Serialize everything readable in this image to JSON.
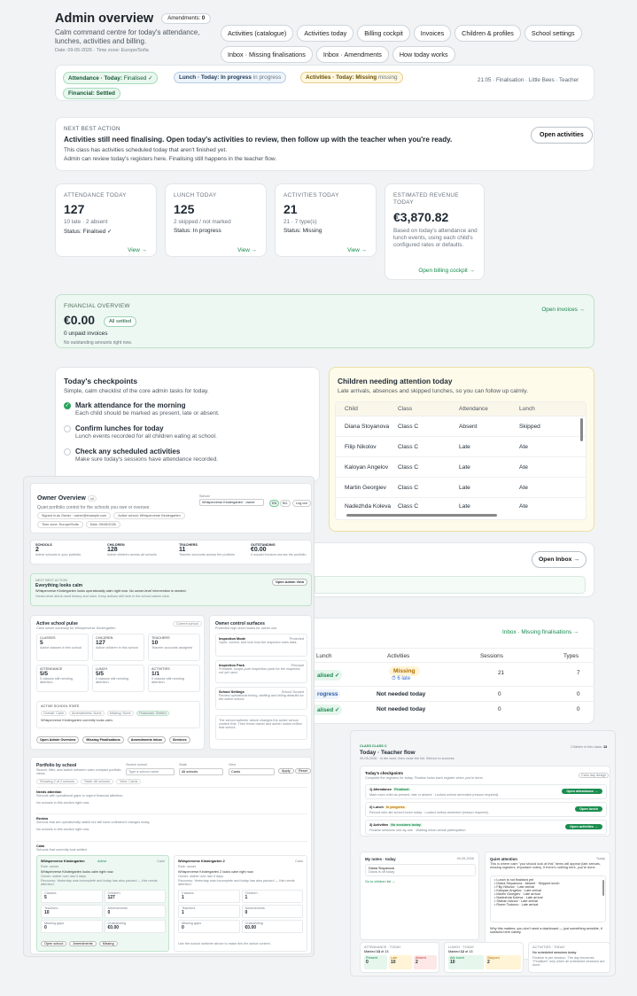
{
  "header": {
    "title": "Admin overview",
    "amend_label": "Amendments:",
    "amend_value": "0",
    "subtitle_1": "Calm command centre for today's attendance,",
    "subtitle_2": "lunches, activities and billing.",
    "meta": "Date: 09-05-2026 · Time zone: Europe/Sofia"
  },
  "nav": [
    "Activities (catalogue)",
    "Activities today",
    "Billing cockpit",
    "Invoices",
    "Children & profiles",
    "School settings",
    "Inbox · Missing finalisations",
    "Inbox · Amendments",
    "How today works"
  ],
  "status": {
    "attendance_label": "Attendance · Today:",
    "attendance_value": "Finalised ✓",
    "lunch_label": "Lunch · Today:",
    "lunch_value": "In progress",
    "lunch_hint": "in progress",
    "activities_label": "Activities · Today:",
    "activities_value": "Missing",
    "activities_hint": "missing",
    "financial_label": "Financial:",
    "financial_value": "Settled",
    "right_note": "21:05 · Finalisation · Little Bees · Teacher"
  },
  "next_action": {
    "kicker": "NEXT BEST ACTION",
    "headline": "Activities still need finalising. Open today's activities to review, then follow up with the teacher when you're ready.",
    "line1": "This class has activities scheduled today that aren't finished yet.",
    "line2": "Admin can review today's registers here. Finalising still happens in the teacher flow.",
    "button": "Open activities"
  },
  "stats": [
    {
      "kicker": "ATTENDANCE TODAY",
      "value": "127",
      "detail": "10 late · 2 absent",
      "status": "Status: Finalised ✓",
      "link": "View →"
    },
    {
      "kicker": "LUNCH TODAY",
      "value": "125",
      "detail": "2 skipped / not marked",
      "status": "Status: In progress",
      "link": "View →"
    },
    {
      "kicker": "ACTIVITIES TODAY",
      "value": "21",
      "detail": "21 · 7 type(s)",
      "status": "Status: Missing",
      "link": "View →"
    },
    {
      "kicker": "ESTIMATED REVENUE TODAY",
      "value": "€3,870.82",
      "detail": "Based on today's attendance and lunch events, using each child's configured rates or defaults.",
      "link": "Open billing cockpit →"
    }
  ],
  "financial": {
    "kicker": "FINANCIAL OVERVIEW",
    "amount": "€0.00",
    "badge": "All settled",
    "unpaid": "0 unpaid invoices",
    "note": "No outstanding amounts right now.",
    "link": "Open invoices →"
  },
  "checkpoints": {
    "title": "Today's checkpoints",
    "subtitle": "Simple, calm checklist of the core admin tasks for today.",
    "items": [
      {
        "title": "Mark attendance for the morning",
        "desc": "Each child should be marked as present, late or absent."
      },
      {
        "title": "Confirm lunches for today",
        "desc": "Lunch events recorded for all children eating at school."
      },
      {
        "title": "Check any scheduled activities",
        "desc": "Make sure today's sessions have attendance recorded."
      }
    ]
  },
  "attention": {
    "title": "Children needing attention today",
    "subtitle": "Late arrivals, absences and skipped lunches, so you can follow up calmly.",
    "headers": [
      "Child",
      "Class",
      "Attendance",
      "Lunch"
    ],
    "rows": [
      [
        "Diana Stoyanova",
        "Class C",
        "Absent",
        "Skipped"
      ],
      [
        "Filip Nikolov",
        "Class C",
        "Late",
        "Ate"
      ],
      [
        "Kaloyan Angelov",
        "Class C",
        "Late",
        "Ate"
      ],
      [
        "Martin Georgiev",
        "Class C",
        "Late",
        "Ate"
      ],
      [
        "Nadezhda Koleva",
        "Class C",
        "Late",
        "Ate"
      ]
    ]
  },
  "inbox_btn": "Open Inbox →",
  "finalisation": {
    "link": "Inbox · Missing finalisations →",
    "headers": [
      "Lunch",
      "Activities",
      "Sessions",
      "Types"
    ],
    "rows": [
      {
        "lunch": "alised ✓",
        "activities": "Missing",
        "sub": "⏱ 6 late",
        "sessions": "21",
        "types": "7"
      },
      {
        "lunch": "rogress",
        "activities": "Not needed today",
        "sub": "",
        "sessions": "0",
        "types": "0"
      },
      {
        "lunch": "alised ✓",
        "activities": "Not needed today",
        "sub": "",
        "sessions": "0",
        "types": "0"
      }
    ]
  },
  "owner": {
    "title": "Owner Overview",
    "title_badge": "v2",
    "subtitle": "Quiet portfolio control for the schools you own or oversee.",
    "chips": [
      "Signed in as Owner · owner@example.com",
      "Active school: Whisperverse Kindergarten",
      "Time zone: Europe/Sofia",
      "Date: 09/05/2026"
    ],
    "school_label": "School",
    "school_value": "Whisperverse Kindergarten · owner",
    "lang": [
      "EN",
      "BG"
    ],
    "logout": "Log out",
    "kpis": [
      {
        "k": "SCHOOLS",
        "v": "2",
        "d": "Active schools in your portfolio"
      },
      {
        "k": "CHILDREN",
        "v": "128",
        "d": "Active children across all schools"
      },
      {
        "k": "TEACHERS",
        "v": "11",
        "d": "Teacher accounts across the portfolio"
      },
      {
        "k": "OUTSTANDING",
        "v": "€0.00",
        "d": "0 unpaid invoices across the portfolio"
      }
    ],
    "nba": {
      "kicker": "NEXT BEST ACTION",
      "title": "Everything looks calm",
      "line1": "Whisperverse Kindergarten looks operationally calm right now. No owner-level intervention is needed.",
      "line2": "Owner-level alerts need history and rules. Keep actions still here in the school admin view.",
      "button": "Open Admin View"
    },
    "pulse": {
      "title": "Active school pulse",
      "subtitle": "Calm owner summary for Whisperverse Kindergarten",
      "tag": "Current school",
      "tiles": [
        {
          "k": "CLASSES",
          "v": "5",
          "d": "Active classes in this school"
        },
        {
          "k": "CHILDREN",
          "v": "127",
          "d": "Active children in this school"
        },
        {
          "k": "TEACHERS",
          "v": "10",
          "d": "Teacher accounts assigned"
        },
        {
          "k": "ATTENDANCE",
          "v": "5/5",
          "d": "0 classes still needing attention"
        },
        {
          "k": "LUNCH",
          "v": "5/5",
          "d": "0 classes still needing attention"
        },
        {
          "k": "ACTIVITIES",
          "v": "1/1",
          "d": "0 classes still needing attention"
        }
      ],
      "state_kicker": "ACTIVE SCHOOL STATE",
      "state_chips": [
        "Overall: Calm",
        "Amendments: None",
        "Missing: None",
        "Financials: Settled"
      ],
      "state_note": "Whisperverse Kindergarten currently looks calm.",
      "buttons": [
        "Open Admin Overview",
        "Missing Finalisations",
        "Amendments Inbox",
        "Services"
      ]
    },
    "surfaces": {
      "title": "Owner control surfaces",
      "subtitle": "Protected high-level routes for owner use.",
      "items": [
        {
          "t": "Inspection Mode",
          "tag": "Protected",
          "d": "Open, control, and lock how the inspector sees data."
        },
        {
          "t": "Inspection Pack",
          "tag": "Principal",
          "d": "Printable, scope-pure inspection pack for the inspector, not yet used"
        },
        {
          "t": "School Settings",
          "tag": "School Scoped",
          "d": "Review operational timing, staffing and billing defaults for the active school."
        }
      ],
      "note": "The school switcher above changes the active school context first. Then these owner and admin routes reflect that school."
    },
    "portfolio": {
      "title": "Portfolio by school",
      "subtitle": "Search, filter, and switch between calm compact portfolio views.",
      "search_label": "Search school",
      "search_ph": "Type a school name",
      "state_label": "State",
      "state_value": "All schools",
      "view_label": "View",
      "view_value": "Cards",
      "apply": "Apply",
      "reset": "Reset",
      "chips": [
        "Showing 2 of 2 schools",
        "State: All schools",
        "View: Cards"
      ],
      "groups": [
        {
          "t": "Needs attention",
          "d": "Schools with operational gaps or urgent financial attention.",
          "empty": "No schools in this section right now."
        },
        {
          "t": "Review",
          "d": "Schools that are operationally stable but still have unfinished changes today.",
          "empty": "No schools in this section right now."
        }
      ],
      "calm": {
        "t": "Calm",
        "d": "Schools that currently look settled."
      },
      "schools": [
        {
          "name": "Whisperverse Kindergarten",
          "tag": "Active",
          "state": "Calm",
          "role": "Role: owner",
          "line1": "Whisperverse Kindergarten looks calm right now.",
          "line2": "Owner: stable over last 3 days",
          "line3": "Recovery: Yesterday was incomplete and today has also paused — this needs attention.",
          "cells": [
            {
              "k": "Classes",
              "v": "5"
            },
            {
              "k": "Children",
              "v": "127"
            },
            {
              "k": "Teachers",
              "v": "10"
            },
            {
              "k": "Amendments",
              "v": "0"
            },
            {
              "k": "Missing gaps",
              "v": "0"
            },
            {
              "k": "Outstanding",
              "v": "€0.00"
            }
          ],
          "buttons": [
            "Open school",
            "Amendments",
            "Missing"
          ]
        },
        {
          "name": "Whisperverse Kindergarten 2",
          "tag": "",
          "state": "Calm",
          "role": "Role: owner",
          "line1": "Whisperverse Kindergarten 2 looks calm right now.",
          "line2": "Owner: stable over last 3 days",
          "line3": "Recovery: Yesterday was incomplete and today has also paused — this needs attention.",
          "cells": [
            {
              "k": "Classes",
              "v": "1"
            },
            {
              "k": "Children",
              "v": "1"
            },
            {
              "k": "Teachers",
              "v": "1"
            },
            {
              "k": "Amendments",
              "v": "0"
            },
            {
              "k": "Missing gaps",
              "v": "0"
            },
            {
              "k": "Outstanding",
              "v": "€0.00"
            }
          ],
          "note": "Use the school switcher above to make this the active context."
        }
      ]
    }
  },
  "teacher": {
    "kicker": "CLASS CLASS C",
    "title": "Today · Teacher flow",
    "meta": "09-05-2026 · In the work, then close the list. Silence to success.",
    "right": "Children in this class:",
    "right_v": "13",
    "checkpoints": {
      "title": "Today's checkpoints",
      "subtitle": "Complete the registers for today. Finalise locks each register when you're done.",
      "demo": "Calm day design",
      "items": [
        {
          "n": "1) Attendance",
          "tag": "Finalised",
          "d": "Mark each child as present, late or absent · Locked unless amended (reason required).",
          "btn": "Open attendance →"
        },
        {
          "n": "2) Lunch",
          "tag": "In progress",
          "d": "Record who ate school lunch today · Locked unless amended (reason required).",
          "btn": "Open lunch"
        },
        {
          "n": "3) Activities",
          "tag": "No sessions today",
          "d": "Finalise sessions one-by-one · Waiting mean actual participation.",
          "btn": "Open activities →"
        }
      ]
    },
    "notes": {
      "title": "My notes · today",
      "date": "09-05-2026",
      "entries": [
        {
          "name": "Diana Stoyanova",
          "d": "Diana is off today"
        },
        {
          "name": "Go to children list →",
          "d": ""
        }
      ]
    },
    "quiet": {
      "title": "Quiet attention",
      "tag": "Today",
      "intro": "This is where calm \"you should look at this\" items will appear (late arrivals, missing registers, important notes). If there's nothing here, you're done.",
      "items": [
        "Lunch is not finalised yet",
        "Diana Stoyanova · Absent · Skipped lunch",
        "Filip Nikolov · Late arrival",
        "Kaloyan Angelov · Late arrival",
        "Martin Georgiev · Late arrival",
        "Nadezhda Koleva · Late arrival",
        "Stanan Ivanov · Late arrival",
        "Roeer Todorov · Late arrival"
      ],
      "foot": "Why this matters: you don't need a dashboard — just something sensible, it surfaces here calmly."
    },
    "bottom": [
      {
        "k": "ATTENDANCE · TODAY",
        "sub": "Marked",
        "sv": "13",
        "st": "of 13",
        "cells": [
          {
            "l": "Present",
            "v": "0",
            "c": "#e6f6ec"
          },
          {
            "l": "Late",
            "v": "10",
            "c": "#fff4d6"
          },
          {
            "l": "Absent",
            "v": "2",
            "c": "#fde7e7"
          }
        ]
      },
      {
        "k": "LUNCH · TODAY",
        "sub": "Marked",
        "sv": "12",
        "st": "of 13",
        "cells": [
          {
            "l": "Ate lunch",
            "v": "10",
            "c": "#e6f6ec"
          },
          {
            "l": "Skipped",
            "v": "2",
            "c": "#fff4d6"
          }
        ]
      },
      {
        "k": "ACTIVITIES · TODAY",
        "sub": "",
        "d": "No scheduled sessions today",
        "d2": "Finalise is per session. The day becomes \"Finalised\" only when all scheduled sessions are done."
      }
    ]
  }
}
